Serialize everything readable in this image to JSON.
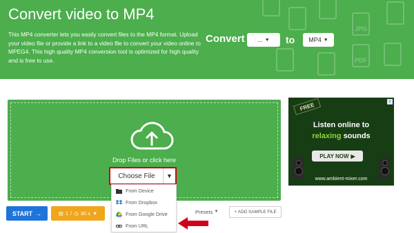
{
  "hero": {
    "title": "Convert video to MP4",
    "description": "This MP4 converter lets you easily convert files to the MP4 format. Upload your video file or provide a link to a video file to convert your video online to MPEG4. This high quality MP4 conversion tool is optimized for high quality and is free to use.",
    "convert_label": "Convert",
    "from_value": "...",
    "to_label": "to",
    "to_value": "MP4",
    "bg_icon_labels": [
      "JPG",
      "PDF"
    ]
  },
  "upload": {
    "drop_text": "Drop Files or click here",
    "choose_label": "Choose File",
    "menu_items": [
      {
        "label": "From Device",
        "icon": "folder-icon"
      },
      {
        "label": "From Dropbox",
        "icon": "dropbox-icon"
      },
      {
        "label": "From Google Drive",
        "icon": "google-drive-icon"
      },
      {
        "label": "From URL",
        "icon": "link-icon"
      }
    ]
  },
  "toolbar": {
    "start_label": "START",
    "options_count": "1",
    "options_time": "30 s",
    "presets_label": "Presets",
    "add_sample_label": "ADD SAMPLE FILE"
  },
  "ad": {
    "badge": "FREE",
    "line1": "Listen online to",
    "line2_highlight": "relaxing",
    "line2_rest": "sounds",
    "button": "PLAY NOW",
    "url": "www.ambient-mixer.com",
    "close": "x"
  },
  "colors": {
    "brand_green": "#4cae4c",
    "start_blue": "#1e74d9",
    "options_orange": "#f0a51a",
    "highlight_red": "#d0021b"
  }
}
